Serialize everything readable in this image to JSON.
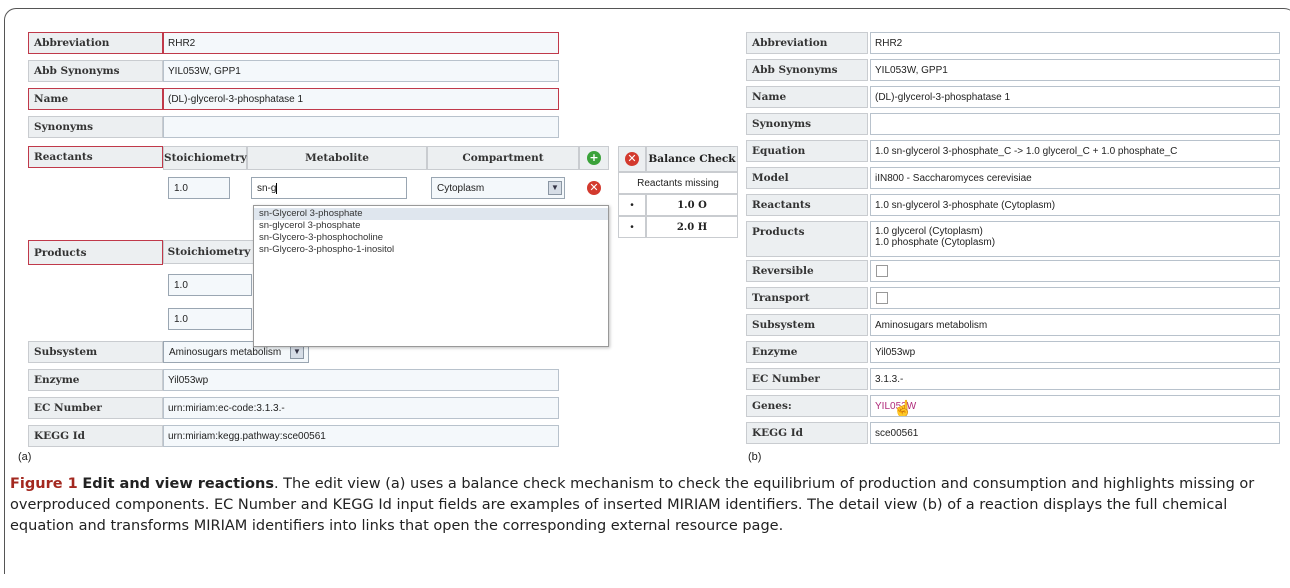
{
  "panel_a": {
    "label": "(a)",
    "abbreviation": {
      "label": "Abbreviation",
      "value": "RHR2"
    },
    "abb_synonyms": {
      "label": "Abb Synonyms",
      "value": "YIL053W, GPP1"
    },
    "name": {
      "label": "Name",
      "value": "(DL)-glycerol-3-phosphatase 1"
    },
    "synonyms": {
      "label": "Synonyms",
      "value": ""
    },
    "reactants": {
      "label": "Reactants",
      "headers": {
        "stoichiometry": "Stoichiometry",
        "metabolite": "Metabolite",
        "compartment": "Compartment"
      },
      "row": {
        "stoichiometry": "1.0",
        "metabolite": "sn-g",
        "compartment": "Cytoplasm"
      }
    },
    "autocomplete": [
      "sn-Glycerol 3-phosphate",
      "sn-glycerol 3-phosphate",
      "sn-Glycero-3-phosphocholine",
      "sn-Glycero-3-phospho-1-inositol"
    ],
    "products": {
      "label": "Products",
      "header": "Stoichiometry",
      "rows": [
        "1.0",
        "1.0"
      ]
    },
    "subsystem": {
      "label": "Subsystem",
      "value": "Aminosugars metabolism"
    },
    "enzyme": {
      "label": "Enzyme",
      "value": "Yil053wp"
    },
    "ec_number": {
      "label": "EC Number",
      "value": "urn:miriam:ec-code:3.1.3.-"
    },
    "kegg_id": {
      "label": "KEGG Id",
      "value": "urn:miriam:kegg.pathway:sce00561"
    }
  },
  "balance": {
    "title": "Balance Check",
    "status": "Reactants missing",
    "rows": [
      {
        "bullet": "•",
        "value": "1.0 O"
      },
      {
        "bullet": "•",
        "value": "2.0 H"
      }
    ]
  },
  "panel_b": {
    "label": "(b)",
    "rows": [
      {
        "label": "Abbreviation",
        "value": "RHR2"
      },
      {
        "label": "Abb Synonyms",
        "value": "YIL053W, GPP1"
      },
      {
        "label": "Name",
        "value": "(DL)-glycerol-3-phosphatase 1"
      },
      {
        "label": "Synonyms",
        "value": ""
      },
      {
        "label": "Equation",
        "value": "1.0 sn-glycerol 3-phosphate_C -> 1.0 glycerol_C + 1.0 phosphate_C"
      },
      {
        "label": "Model",
        "value": "iIN800 - Saccharomyces cerevisiae"
      },
      {
        "label": "Reactants",
        "value": "1.0 sn-glycerol 3-phosphate (Cytoplasm)"
      }
    ],
    "products": {
      "label": "Products",
      "line1": "1.0 glycerol (Cytoplasm)",
      "line2": "1.0 phosphate (Cytoplasm)"
    },
    "reversible": {
      "label": "Reversible"
    },
    "transport": {
      "label": "Transport"
    },
    "subsystem": {
      "label": "Subsystem",
      "value": "Aminosugars metabolism"
    },
    "enzyme": {
      "label": "Enzyme",
      "value": "Yil053wp"
    },
    "ec_number": {
      "label": "EC Number",
      "value": "3.1.3.-"
    },
    "genes": {
      "label": "Genes:",
      "value": "YIL053W"
    },
    "kegg_id": {
      "label": "KEGG Id",
      "value": "sce00561"
    }
  },
  "caption": {
    "figure": "Figure 1",
    "title": "Edit and view reactions",
    "text1": ". The edit view ",
    "a": "(a)",
    "text2": " uses a balance check mechanism to check the equilibrium of production and consumption and highlights missing or overproduced components. EC Number and KEGG Id input fields are examples of inserted MIRIAM identifiers. The detail view ",
    "b": "(b)",
    "text3": " of a reaction displays the full chemical equation and transforms MIRIAM identifiers into links that open the corresponding external resource page."
  },
  "colors": {
    "required_border": "#c0394a",
    "link": "#b02a7a",
    "add_icon": "#3aa23a",
    "delete_icon": "#d33a2e"
  }
}
